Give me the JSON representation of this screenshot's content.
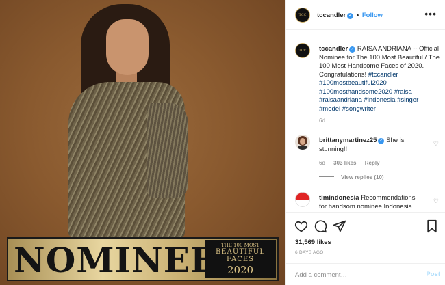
{
  "photo": {
    "banner_word": "NOMINEE",
    "badge": {
      "line1": "THE 100 MOST",
      "line2": "BEAUTIFUL",
      "line3": "FACES",
      "line4": "2020"
    }
  },
  "header": {
    "avatar_text": "TCC",
    "username": "tccandler",
    "separator": "•",
    "follow_label": "Follow",
    "more_icon": "more-horizontal-icon"
  },
  "caption": {
    "username": "tccandler",
    "text": " RAISA ANDRIANA -- Official Nominee for The 100 Most Beautiful / The 100 Most Handsome Faces of 2020. Congratulations! ",
    "hashtags": "#tccandler #100mostbeautiful2020 #100mosthandsome2020 #raisa #raisaandriana #indonesia #singer #model #songwriter",
    "time": "6d"
  },
  "comments": [
    {
      "username": "brittanymartinez25",
      "text": " She is stunning!!",
      "time": "6d",
      "likes": "303 likes",
      "reply": "Reply",
      "view_replies": "View replies (10)"
    },
    {
      "username": "timindonesia",
      "text": " Recommendations for handsom nominee Indonesia"
    }
  ],
  "actions": {
    "likes": "31,569 likes",
    "ago": "6 DAYS AGO",
    "icons": [
      "heart-icon",
      "comment-icon",
      "share-icon",
      "bookmark-icon"
    ]
  },
  "add_comment": {
    "placeholder": "Add a comment…",
    "post_label": "Post"
  },
  "colors": {
    "accent": "#3897f0",
    "hashtag": "#00376b",
    "muted": "#8e8e8e"
  }
}
